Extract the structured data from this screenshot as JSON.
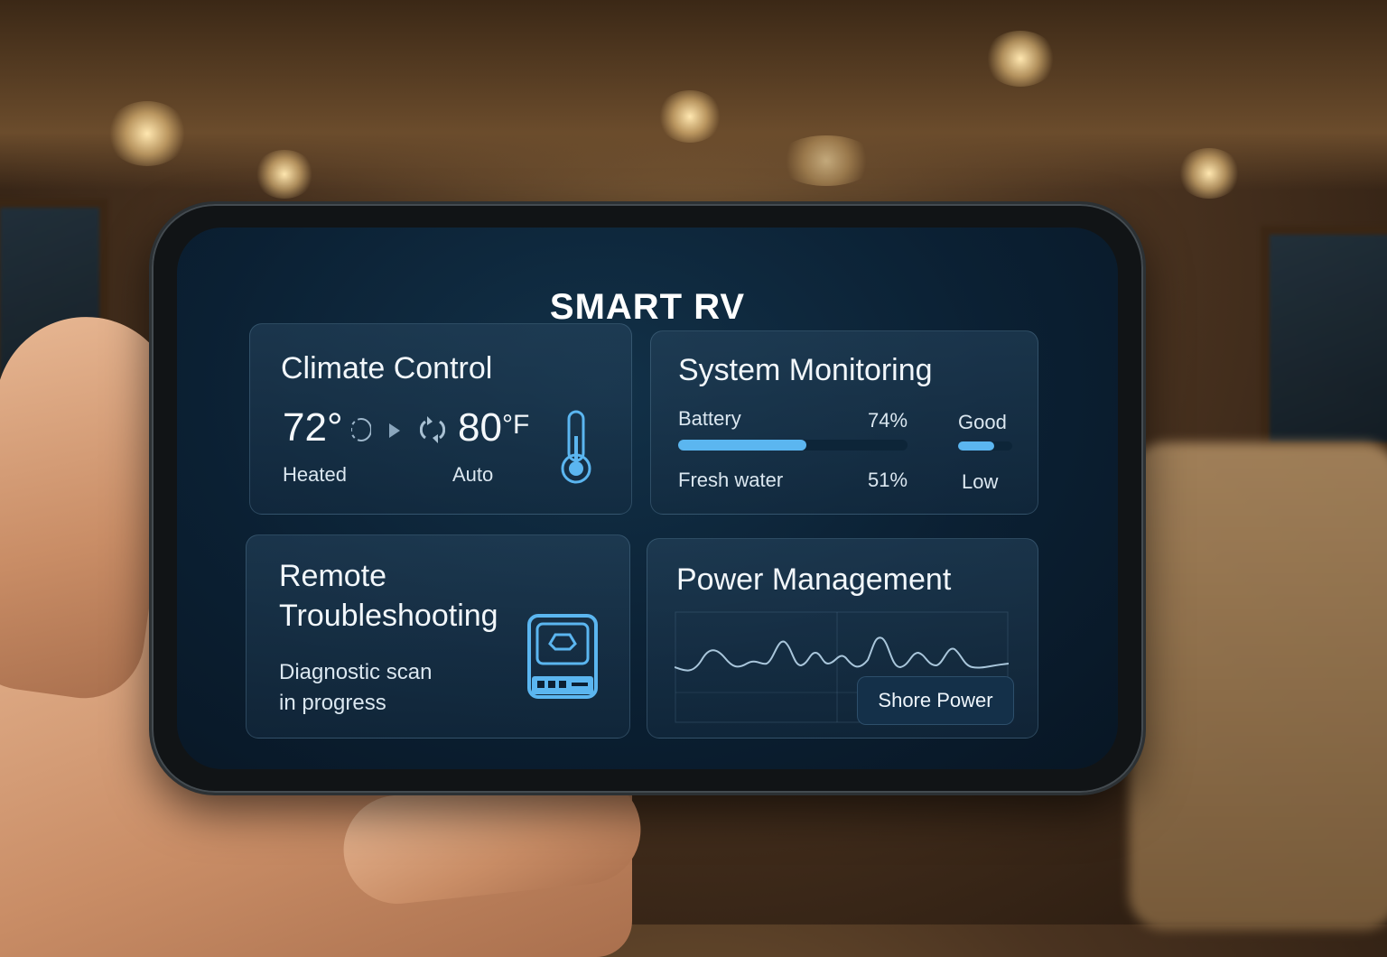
{
  "app": {
    "title": "SMART RV"
  },
  "colors": {
    "accent": "#5bb6f0",
    "panel": "#0b2033",
    "text": "#f2f7fb"
  },
  "climate": {
    "title": "Climate Control",
    "current_temp": "72°",
    "current_mode": "Heated",
    "target_temp": "80",
    "unit": "°F",
    "target_mode": "Auto",
    "icons": [
      "cycle-icon",
      "play-arrow-icon",
      "refresh-icon",
      "thermometer-icon"
    ]
  },
  "monitoring": {
    "title": "System Monitoring",
    "battery": {
      "label": "Battery",
      "percent_text": "74%",
      "level": 0.56,
      "status": "Good",
      "status_level": 0.67
    },
    "fresh_water": {
      "label": "Fresh water",
      "percent_text": "51%",
      "status": "Low"
    }
  },
  "troubleshooting": {
    "title_line1": "Remote",
    "title_line2": "Troubleshooting",
    "status_line1": "Diagnostic scan",
    "status_line2": "in progress",
    "icon": "diagnostic-device-icon"
  },
  "power": {
    "title": "Power Management",
    "source_button": "Shore Power",
    "icon": "waveform-graph"
  }
}
